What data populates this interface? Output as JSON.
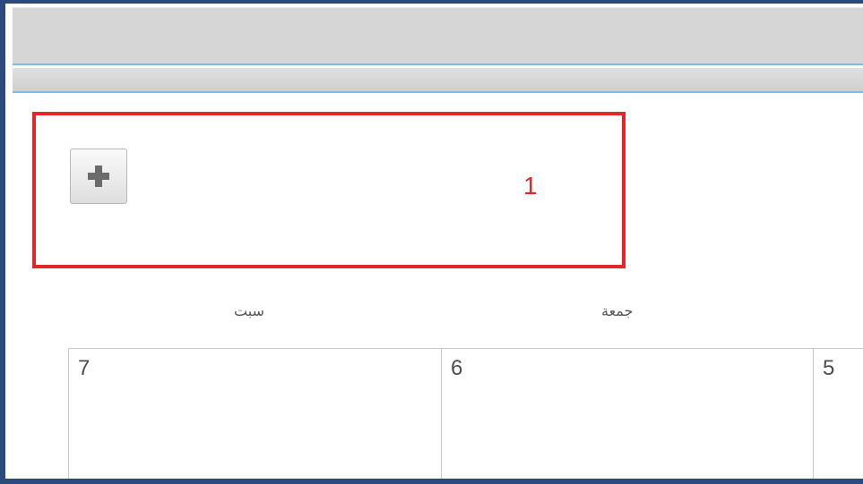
{
  "annotation": {
    "number": "1",
    "color": "#e3262a"
  },
  "toolbar": {
    "add_icon": "plus-icon"
  },
  "calendar": {
    "day_headers": [
      "سبت",
      "جمعة"
    ],
    "cells": [
      "7",
      "6",
      "5"
    ]
  },
  "colors": {
    "frame_border": "#2c4a7e",
    "header_bg": "#d6d6d6",
    "accent_line": "#7bbbe6"
  }
}
